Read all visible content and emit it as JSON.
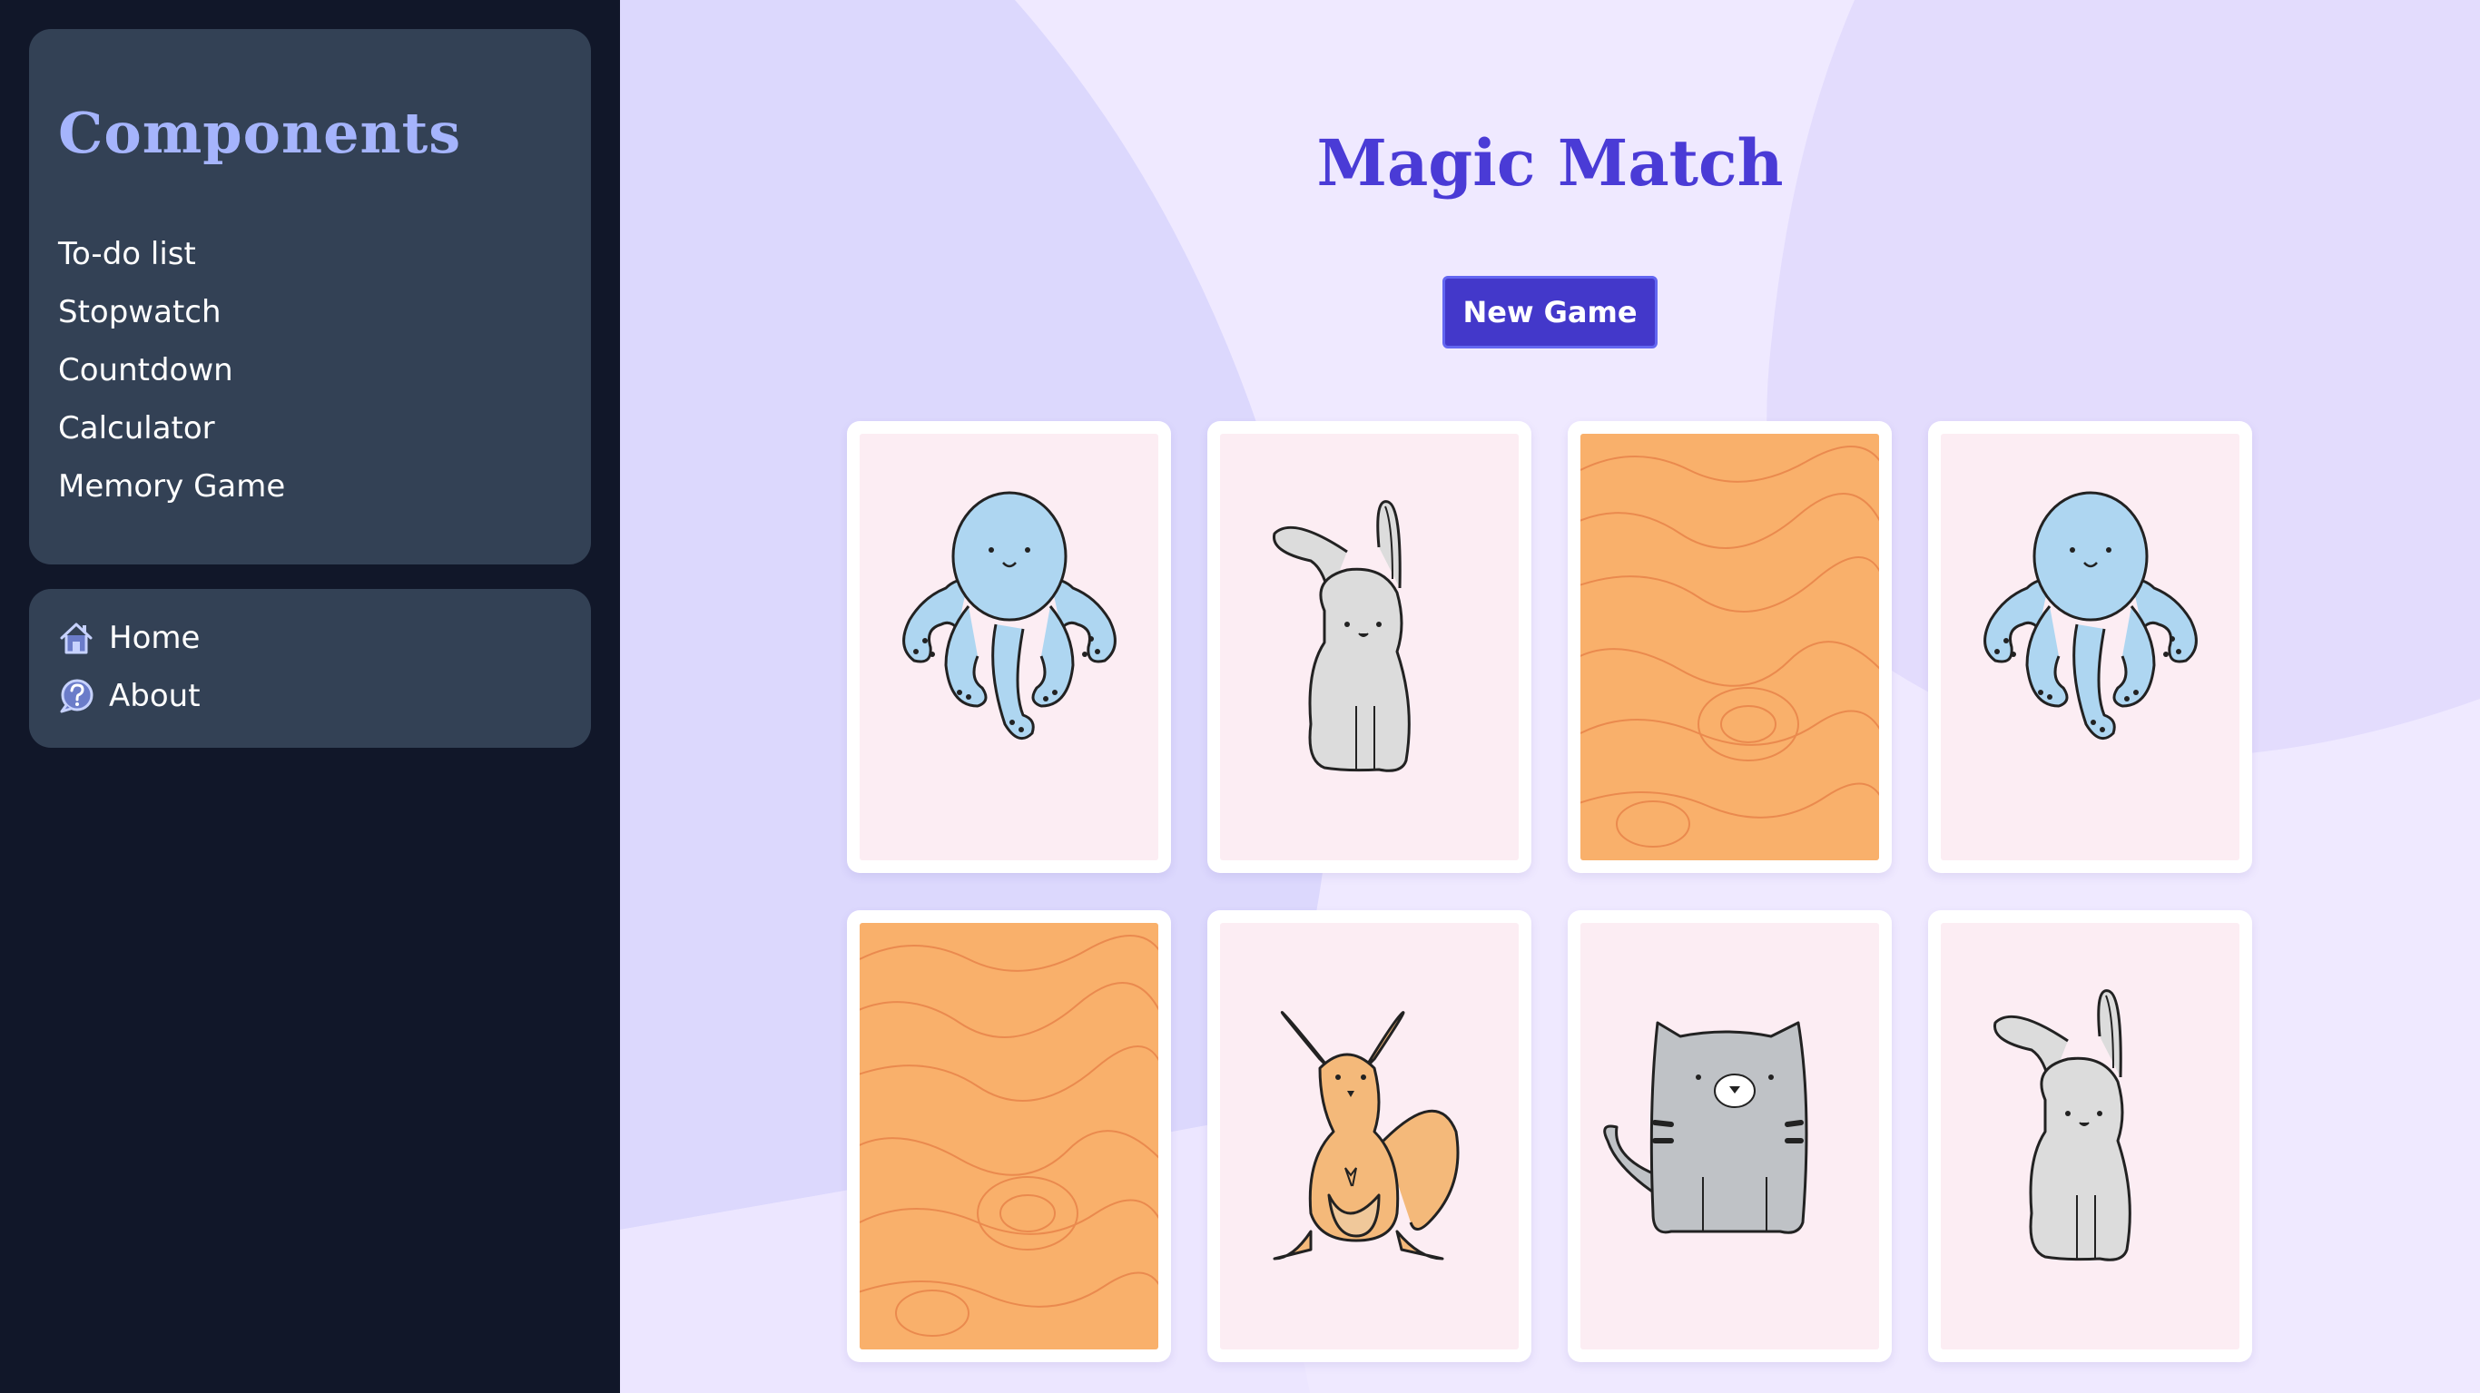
{
  "sidebar": {
    "title": "Components",
    "items": [
      {
        "label": "To-do list"
      },
      {
        "label": "Stopwatch"
      },
      {
        "label": "Countdown"
      },
      {
        "label": "Calculator"
      },
      {
        "label": "Memory Game"
      }
    ],
    "links": [
      {
        "label": "Home",
        "icon": "home-icon"
      },
      {
        "label": "About",
        "icon": "question-icon"
      }
    ]
  },
  "game": {
    "title": "Magic Match",
    "new_game_label": "New Game",
    "cards": [
      {
        "state": "face-up",
        "animal": "octopus"
      },
      {
        "state": "face-up",
        "animal": "rabbit"
      },
      {
        "state": "face-down",
        "animal": ""
      },
      {
        "state": "face-up",
        "animal": "octopus"
      },
      {
        "state": "face-down",
        "animal": ""
      },
      {
        "state": "face-up",
        "animal": "kangaroo"
      },
      {
        "state": "face-up",
        "animal": "cat"
      },
      {
        "state": "face-up",
        "animal": "rabbit"
      }
    ]
  },
  "colors": {
    "sidebar_bg": "#111729",
    "panel_bg": "#334155",
    "title_accent": "#a5b4fc",
    "game_title": "#4a3bd6",
    "button_bg": "#4338ca",
    "card_back": "#f9b06b",
    "card_front": "#fcedf3"
  }
}
